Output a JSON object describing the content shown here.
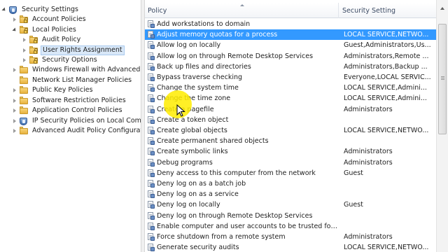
{
  "tree": {
    "items": [
      {
        "label": "Security Settings",
        "expander": "open",
        "icon": "shield-icon"
      },
      {
        "label": "Account Policies",
        "expander": "closed",
        "icon": "folder-lock-icon"
      },
      {
        "label": "Local Policies",
        "expander": "open",
        "icon": "folder-lock-icon"
      },
      {
        "label": "Audit Policy",
        "expander": "closed",
        "icon": "folder-lock-icon"
      },
      {
        "label": "User Rights Assignment",
        "expander": "closed",
        "icon": "folder-lock-icon",
        "selected": true
      },
      {
        "label": "Security Options",
        "expander": "closed",
        "icon": "folder-lock-icon"
      },
      {
        "label": "Windows Firewall with Advanced Sec",
        "expander": "closed",
        "icon": "folder-icon"
      },
      {
        "label": "Network List Manager Policies",
        "expander": "none",
        "icon": "folder-icon"
      },
      {
        "label": "Public Key Policies",
        "expander": "closed",
        "icon": "folder-icon"
      },
      {
        "label": "Software Restriction Policies",
        "expander": "closed",
        "icon": "folder-icon"
      },
      {
        "label": "Application Control Policies",
        "expander": "closed",
        "icon": "folder-icon"
      },
      {
        "label": "IP Security Policies on Local Compute",
        "expander": "closed",
        "icon": "shield-icon"
      },
      {
        "label": "Advanced Audit Policy Configuration",
        "expander": "closed",
        "icon": "folder-icon"
      }
    ]
  },
  "list": {
    "columns": {
      "policy": "Policy",
      "setting": "Security Setting"
    },
    "rows": [
      {
        "policy": "Add workstations to domain",
        "setting": ""
      },
      {
        "policy": "Adjust memory quotas for a process",
        "setting": "LOCAL SERVICE,NETWO...",
        "selected": true
      },
      {
        "policy": "Allow log on locally",
        "setting": "Guest,Administrators,Us..."
      },
      {
        "policy": "Allow log on through Remote Desktop Services",
        "setting": "Administrators,Remote ..."
      },
      {
        "policy": "Back up files and directories",
        "setting": "Administrators,Backup ..."
      },
      {
        "policy": "Bypass traverse checking",
        "setting": "Everyone,LOCAL SERVIC..."
      },
      {
        "policy": "Change the system time",
        "setting": "LOCAL SERVICE,Admini..."
      },
      {
        "policy": "Change the time zone",
        "setting": "LOCAL SERVICE,Admini..."
      },
      {
        "policy": "Create a pagefile",
        "setting": "Administrators"
      },
      {
        "policy": "Create a token object",
        "setting": ""
      },
      {
        "policy": "Create global objects",
        "setting": "LOCAL SERVICE,NETWO..."
      },
      {
        "policy": "Create permanent shared objects",
        "setting": ""
      },
      {
        "policy": "Create symbolic links",
        "setting": "Administrators"
      },
      {
        "policy": "Debug programs",
        "setting": "Administrators"
      },
      {
        "policy": "Deny access to this computer from the network",
        "setting": "Guest"
      },
      {
        "policy": "Deny log on as a batch job",
        "setting": ""
      },
      {
        "policy": "Deny log on as a service",
        "setting": ""
      },
      {
        "policy": "Deny log on locally",
        "setting": "Guest"
      },
      {
        "policy": "Deny log on through Remote Desktop Services",
        "setting": ""
      },
      {
        "policy": "Enable computer and user accounts to be trusted for delega...",
        "setting": ""
      },
      {
        "policy": "Force shutdown from a remote system",
        "setting": "Administrators"
      },
      {
        "policy": "Generate security audits",
        "setting": "LOCAL SERVICE,NETWO..."
      }
    ]
  },
  "colors": {
    "selection": "#3399ff",
    "tree_selection": "#d9e8f8",
    "cursor_highlight": "#ffec00"
  }
}
